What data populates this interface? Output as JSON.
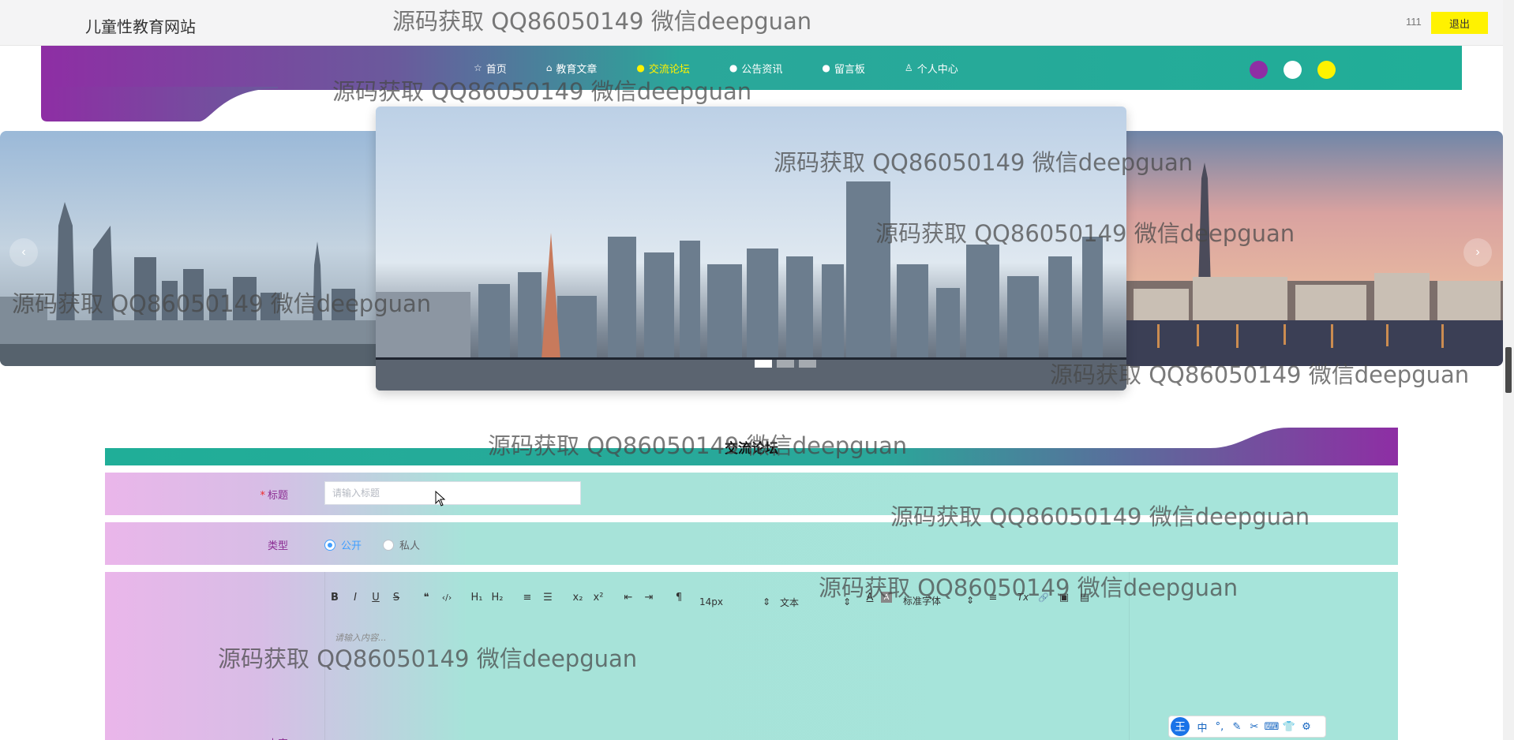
{
  "header": {
    "site_title": "儿童性教育网站",
    "user_name": "111",
    "logout_label": "退出"
  },
  "nav": {
    "items": [
      {
        "label": "首页",
        "icon": "star-icon",
        "active": false
      },
      {
        "label": "教育文章",
        "icon": "bag-icon",
        "active": false
      },
      {
        "label": "交流论坛",
        "icon": "circle-icon",
        "active": true
      },
      {
        "label": "公告资讯",
        "icon": "circle-icon",
        "active": false
      },
      {
        "label": "留言板",
        "icon": "question-icon",
        "active": false
      },
      {
        "label": "个人中心",
        "icon": "user-icon",
        "active": false
      }
    ],
    "theme_colors": [
      "#8e2ea4",
      "#ffffff",
      "#fff200"
    ]
  },
  "carousel": {
    "prev": "‹",
    "next": "›",
    "slides_count": 3,
    "active_index": 0
  },
  "section": {
    "title": "交流论坛"
  },
  "form": {
    "title_label": "标题",
    "title_required_mark": "*",
    "title_placeholder": "请输入标题",
    "title_value": "",
    "type_label": "类型",
    "type_options": [
      "公开",
      "私人"
    ],
    "type_selected": "公开",
    "content_label": "内容",
    "editor_placeholder": "请输入内容...",
    "toolbar": {
      "bold": "B",
      "italic": "I",
      "underline": "U",
      "strike": "S",
      "quote": "❝",
      "code": "‹/›",
      "h1": "H₁",
      "h2": "H₂",
      "ordered_list": "≡",
      "bullet_list": "☰",
      "sub": "x₂",
      "sup": "x²",
      "outdent": "⇤",
      "indent": "⇥",
      "direction": "¶",
      "font_size": "14px",
      "text_type": "文本",
      "font_color": "A",
      "bg_color": "A",
      "font_family": "标准字体",
      "align": "≡",
      "clean": "Tx",
      "link": "🔗",
      "image": "▣",
      "video": "▤"
    }
  },
  "ime": {
    "logo": "王",
    "items": [
      "中",
      "°,",
      "✎",
      "✂",
      "⌨",
      "👕",
      "⚙"
    ]
  },
  "watermark": "源码获取 QQ86050149 微信deepguan"
}
